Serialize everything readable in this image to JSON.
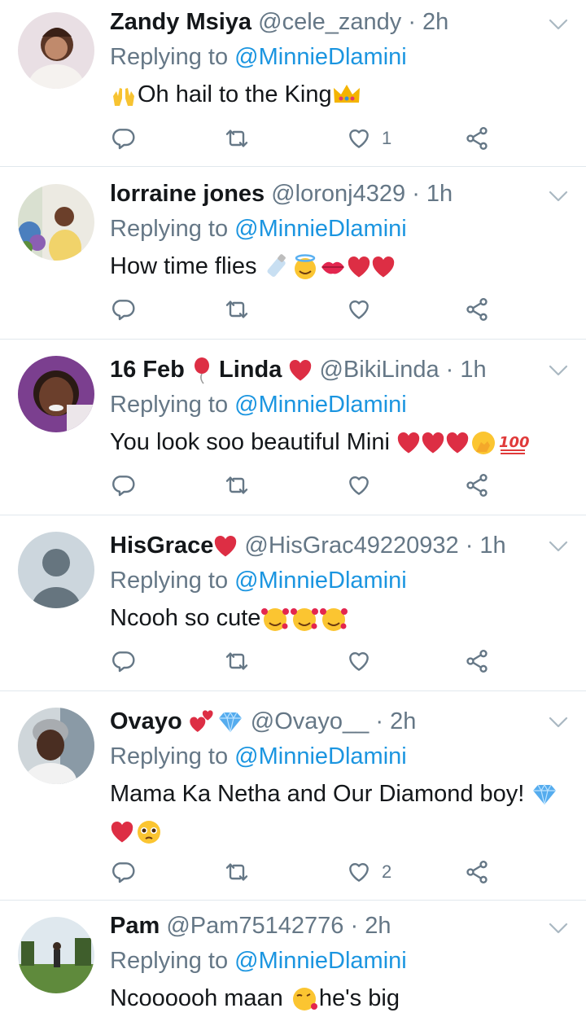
{
  "reply_prefix": "Replying to",
  "colors": {
    "link": "#1b95e0",
    "muted": "#657786",
    "text": "#14171a",
    "heart": "#e0245e",
    "divider": "#e1e8ed"
  },
  "icons": {
    "reply": "reply-icon",
    "retweet": "retweet-icon",
    "like": "like-icon",
    "share": "share-icon",
    "menu": "chevron-down-icon"
  },
  "tweets": [
    {
      "name": "Zandy Msiya",
      "handle": "@cele_zandy",
      "time": "· 2h",
      "mention": "@MinnieDlamini",
      "text": "Oh hail to the King",
      "likes": "1"
    },
    {
      "name": "lorraine jones",
      "handle": "@loronj4329",
      "time": "· 1h",
      "mention": "@MinnieDlamini",
      "text": "How time flies",
      "likes": ""
    },
    {
      "name_prefix": "16 Feb",
      "name": "Linda",
      "handle": "@BikiLinda",
      "time": "· 1h",
      "mention": "@MinnieDlamini",
      "text": "You look soo beautiful Mini",
      "likes": ""
    },
    {
      "name": "HisGrace",
      "handle": "@HisGrac49220932",
      "time": "· 1h",
      "mention": "@MinnieDlamini",
      "text": "Ncooh so cute",
      "likes": ""
    },
    {
      "name": "Ovayo",
      "handle": "@Ovayo__",
      "time": "· 2h",
      "mention": "@MinnieDlamini",
      "text": "Mama Ka Netha and Our Diamond boy!",
      "likes": "2"
    },
    {
      "name": "Pam",
      "handle": "@Pam75142776",
      "time": "· 2h",
      "mention": "@MinnieDlamini",
      "text": "Ncoooooh maan",
      "text2": "he's big",
      "likes": ""
    }
  ]
}
